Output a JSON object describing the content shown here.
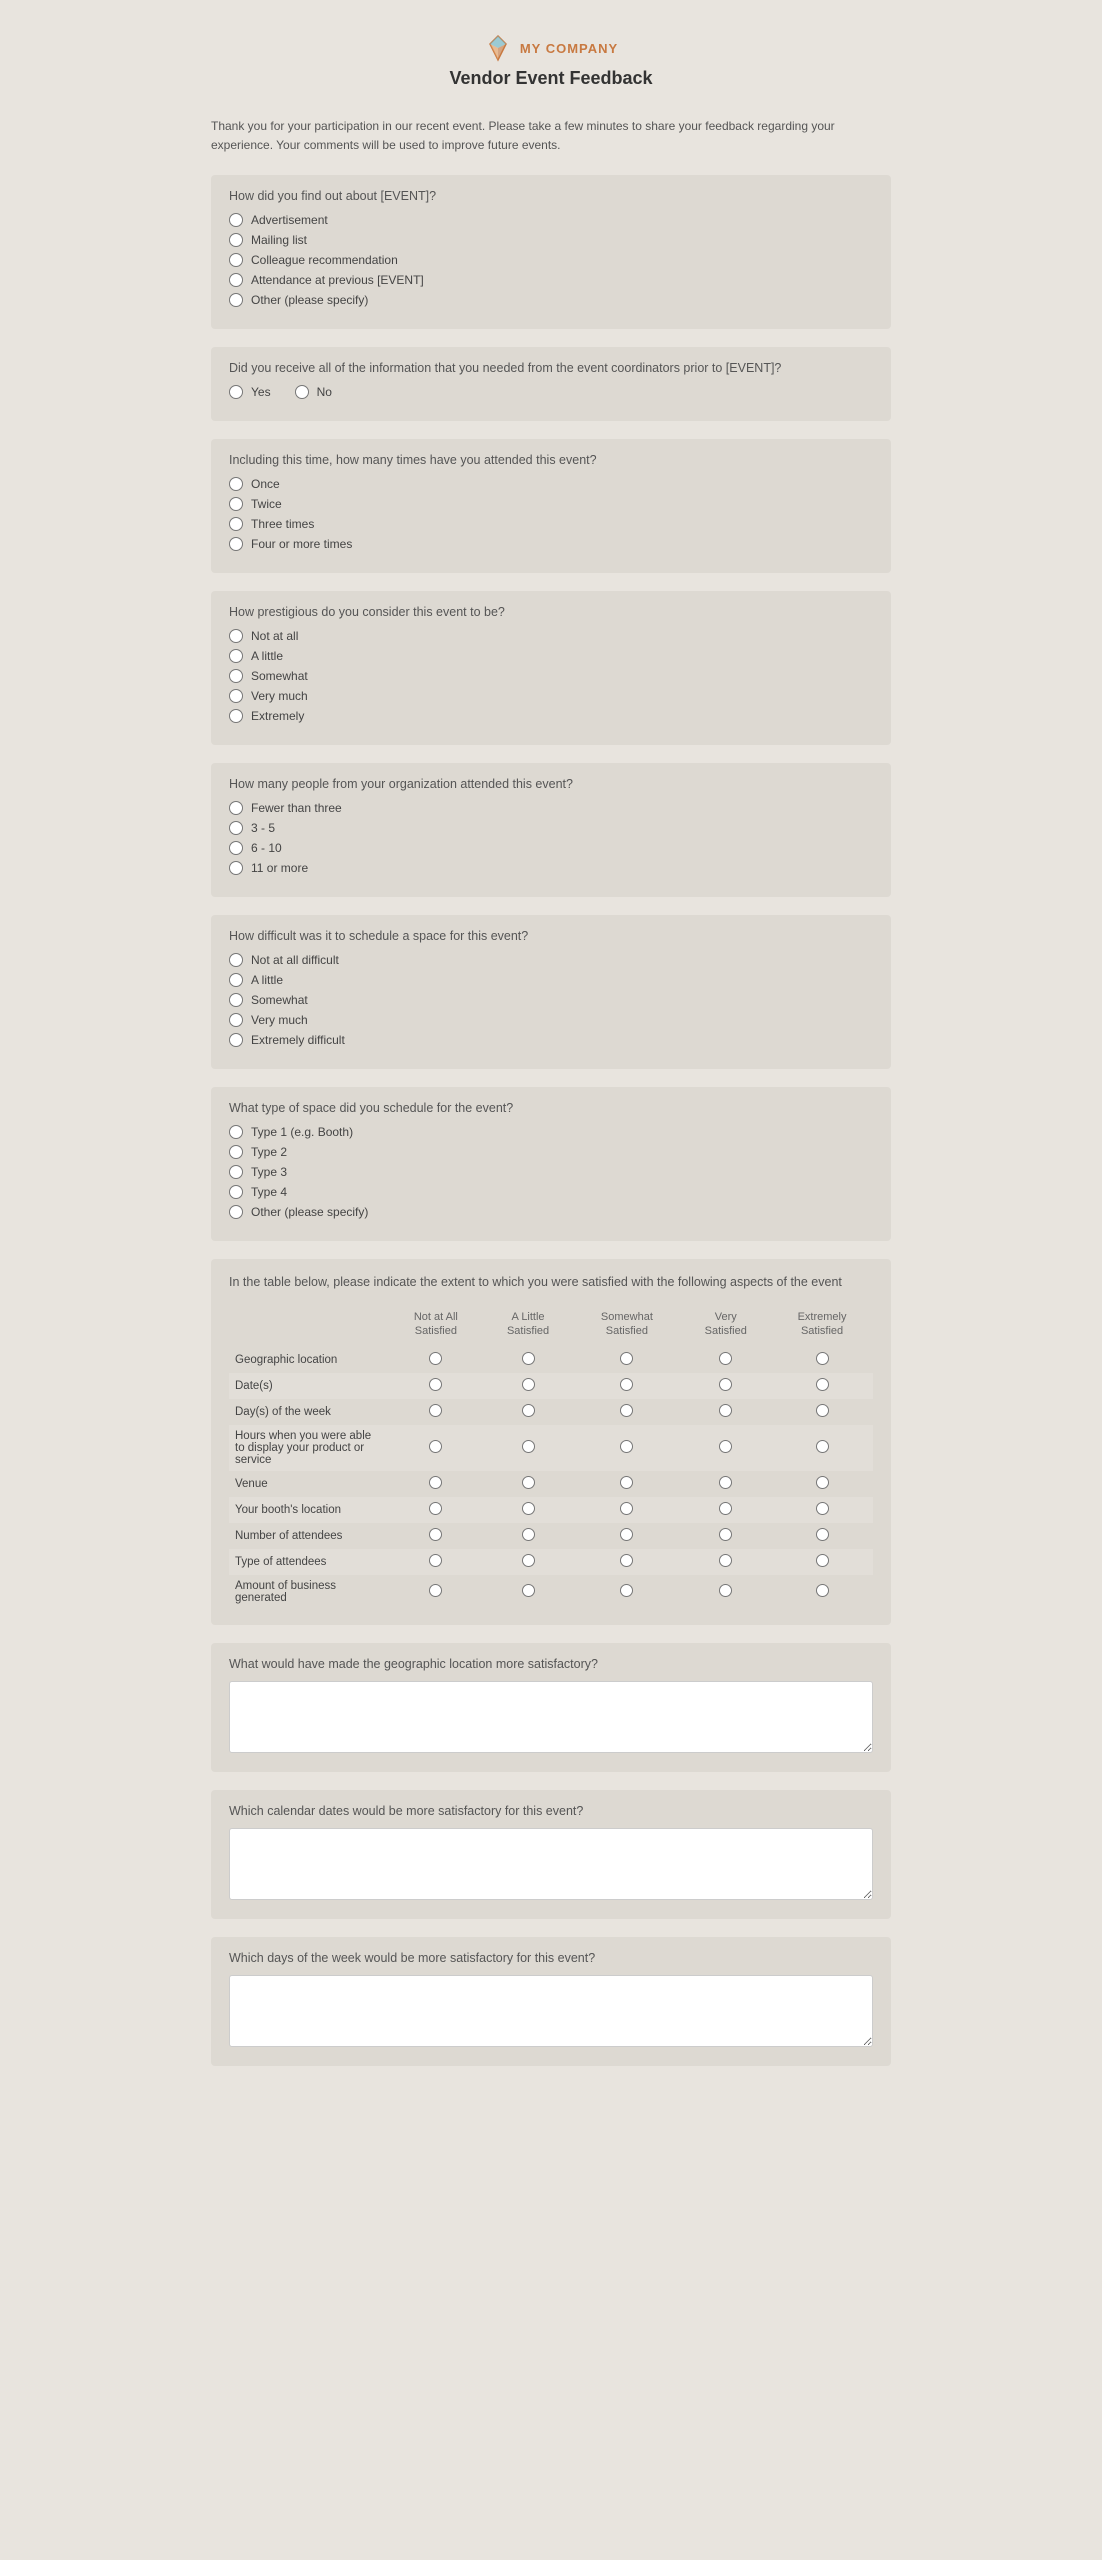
{
  "company": {
    "name": "MY COMPANY"
  },
  "page": {
    "title": "Vendor Event Feedback",
    "intro": "Thank you for your participation in our recent event. Please take a few minutes to share your feedback regarding your experience. Your comments will be used to improve future events."
  },
  "questions": {
    "q1": {
      "label": "How did you find out about [EVENT]?",
      "options": [
        "Advertisement",
        "Mailing list",
        "Colleague recommendation",
        "Attendance at previous [EVENT]",
        "Other (please specify)"
      ]
    },
    "q2": {
      "label": "Did you receive all of the information that you needed from the event coordinators prior to [EVENT]?",
      "options": [
        "Yes",
        "No"
      ]
    },
    "q3": {
      "label": "Including this time, how many times have you attended this event?",
      "options": [
        "Once",
        "Twice",
        "Three times",
        "Four or more times"
      ]
    },
    "q4": {
      "label": "How prestigious do you consider this event to be?",
      "options": [
        "Not at all",
        "A little",
        "Somewhat",
        "Very much",
        "Extremely"
      ]
    },
    "q5": {
      "label": "How many people from your organization attended this event?",
      "options": [
        "Fewer than three",
        "3 - 5",
        "6 - 10",
        "11 or more"
      ]
    },
    "q6": {
      "label": "How difficult was it to schedule a space for this event?",
      "options": [
        "Not at all difficult",
        "A little",
        "Somewhat",
        "Very much",
        "Extremely difficult"
      ]
    },
    "q7": {
      "label": "What type of space did you schedule for the event?",
      "options": [
        "Type 1 (e.g. Booth)",
        "Type 2",
        "Type 3",
        "Type 4",
        "Other (please specify)"
      ]
    },
    "q8": {
      "label": "In the table below, please indicate the extent to which you were satisfied with the following aspects of the event",
      "columns": [
        "Not at All Satisfied",
        "A Little Satisfied",
        "Somewhat Satisfied",
        "Very Satisfied",
        "Extremely Satisfied"
      ],
      "rows": [
        "Geographic location",
        "Date(s)",
        "Day(s) of the week",
        "Hours when you were able to display your product or service",
        "Venue",
        "Your booth's location",
        "Number of attendees",
        "Type of attendees",
        "Amount of business generated"
      ]
    },
    "q9": {
      "label": "What would have made the geographic location more satisfactory?"
    },
    "q10": {
      "label": "Which calendar dates would be more satisfactory for this event?"
    },
    "q11": {
      "label": "Which days of the week would be more satisfactory for this event?"
    }
  }
}
